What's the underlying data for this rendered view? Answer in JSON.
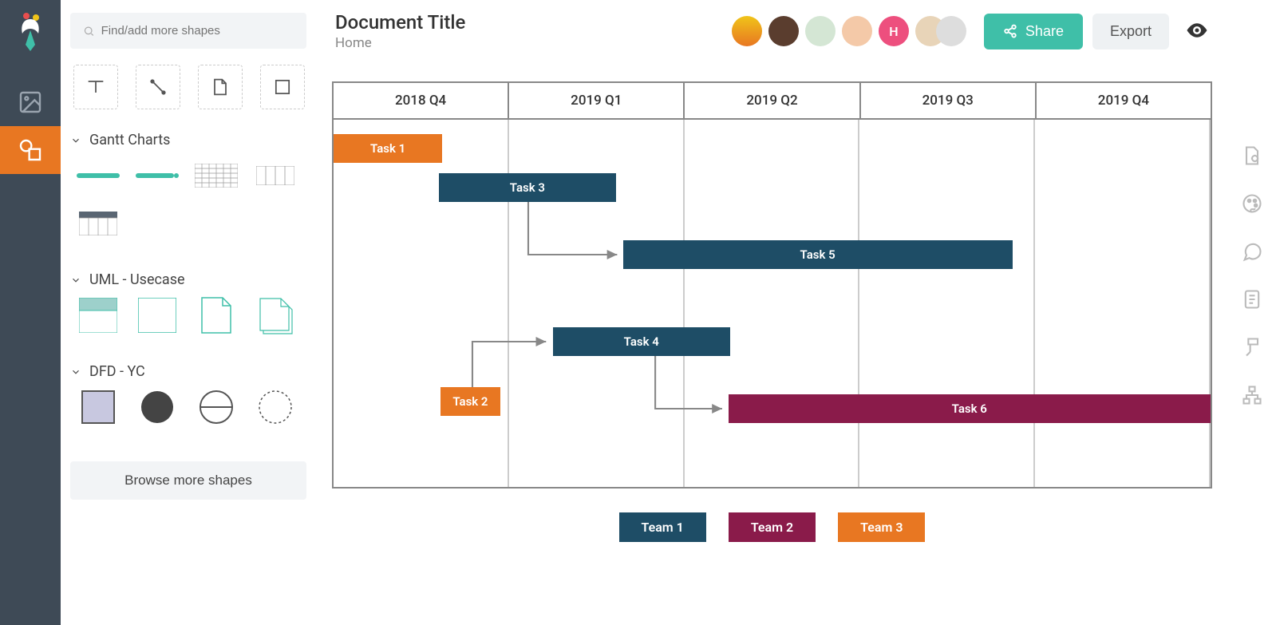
{
  "search": {
    "placeholder": "Find/add more shapes"
  },
  "sections": {
    "gantt": "Gantt Charts",
    "uml": "UML - Usecase",
    "dfd": "DFD - YC"
  },
  "browse": "Browse more shapes",
  "document": {
    "title": "Document Title",
    "breadcrumb": "Home"
  },
  "avatars": {
    "initial": "H"
  },
  "share": "Share",
  "export": "Export",
  "gantt_columns": [
    "2018 Q4",
    "2019 Q1",
    "2019 Q2",
    "2019 Q3",
    "2019 Q4"
  ],
  "tasks": {
    "t1": "Task 1",
    "t2": "Task 2",
    "t3": "Task 3",
    "t4": "Task 4",
    "t5": "Task 5",
    "t6": "Task 6"
  },
  "legend": {
    "team1": "Team 1",
    "team2": "Team 2",
    "team3": "Team 3"
  },
  "chart_data": {
    "type": "gantt",
    "columns": [
      "2018 Q4",
      "2019 Q1",
      "2019 Q2",
      "2019 Q3",
      "2019 Q4"
    ],
    "column_count": 5,
    "tasks": [
      {
        "name": "Task 1",
        "team": "Team 3",
        "color": "#e87722",
        "start_col": 0.0,
        "end_col": 0.62,
        "row": 0
      },
      {
        "name": "Task 3",
        "team": "Team 1",
        "color": "#1e4d66",
        "start_col": 0.6,
        "end_col": 1.61,
        "row": 1
      },
      {
        "name": "Task 5",
        "team": "Team 1",
        "color": "#1e4d66",
        "start_col": 1.65,
        "end_col": 3.87,
        "row": 2
      },
      {
        "name": "Task 4",
        "team": "Team 1",
        "color": "#1e4d66",
        "start_col": 1.25,
        "end_col": 2.26,
        "row": 3
      },
      {
        "name": "Task 2",
        "team": "Team 3",
        "color": "#e87722",
        "start_col": 0.61,
        "end_col": 0.95,
        "row": 4
      },
      {
        "name": "Task 6",
        "team": "Team 2",
        "color": "#8a1b4a",
        "start_col": 2.25,
        "end_col": 5.0,
        "row": 5
      }
    ],
    "dependencies": [
      {
        "from": "Task 2",
        "to": "Task 4"
      },
      {
        "from": "Task 3",
        "to": "Task 5"
      },
      {
        "from": "Task 4",
        "to": "Task 6"
      }
    ],
    "legend": [
      {
        "name": "Team 1",
        "color": "#1e4d66"
      },
      {
        "name": "Team 2",
        "color": "#8a1b4a"
      },
      {
        "name": "Team 3",
        "color": "#e87722"
      }
    ]
  }
}
